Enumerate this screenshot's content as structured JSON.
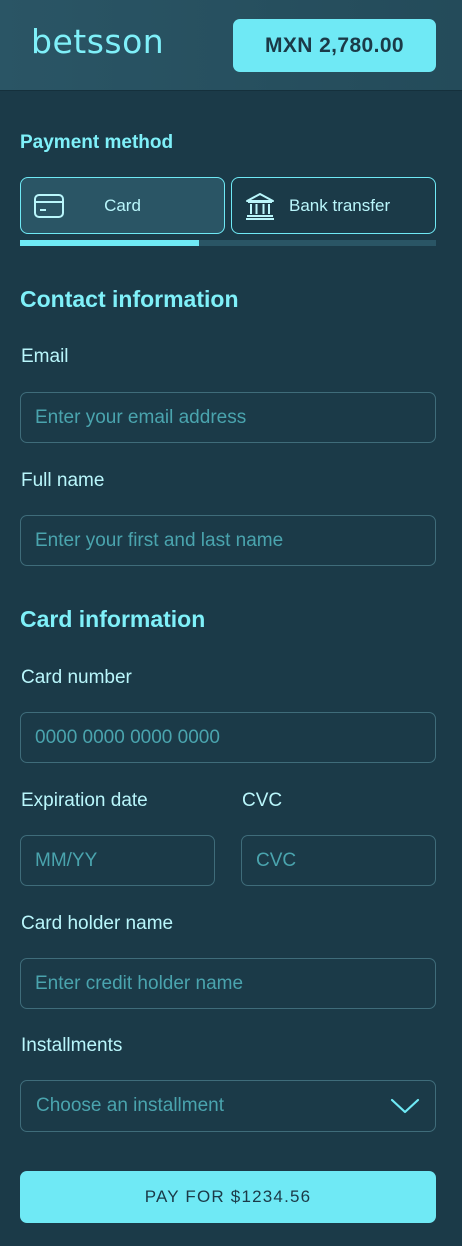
{
  "header": {
    "logo": "betsson",
    "balance": "MXN 2,780.00"
  },
  "payment_method": {
    "label": "Payment method",
    "tabs": [
      {
        "label": "Card",
        "icon": "credit-card-icon",
        "active": true
      },
      {
        "label": "Bank transfer",
        "icon": "bank-icon",
        "active": false
      }
    ],
    "progress_fraction": 0.43
  },
  "contact": {
    "title": "Contact information",
    "email_label": "Email",
    "email_placeholder": "Enter your email address",
    "name_label": "Full name",
    "name_placeholder": "Enter your first and last name"
  },
  "card": {
    "title": "Card information",
    "number_label": "Card number",
    "number_placeholder": "0000 0000 0000 0000",
    "expiry_label": "Expiration date",
    "expiry_placeholder": "MM/YY",
    "cvc_label": "CVC",
    "cvc_placeholder": "CVC",
    "holder_label": "Card holder name",
    "holder_placeholder": "Enter credit holder name",
    "installments_label": "Installments",
    "installments_placeholder": "Choose an installment"
  },
  "pay_button": "PAY FOR $1234.56",
  "colors": {
    "background": "#1b3a48",
    "accent": "#6fe9f5",
    "header": "#2a5565"
  }
}
